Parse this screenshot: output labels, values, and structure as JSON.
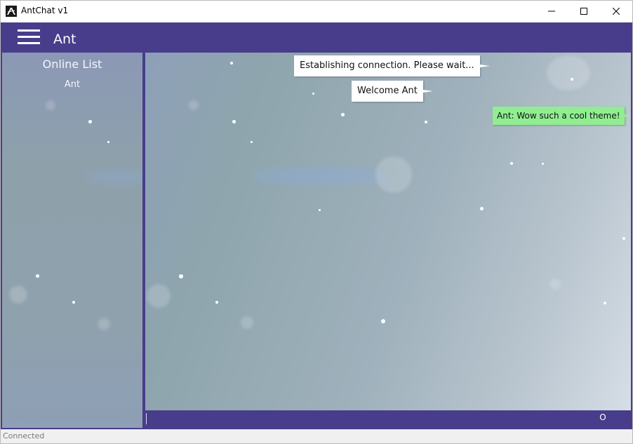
{
  "window": {
    "title": "AntChat v1",
    "controls": [
      "minimize-icon",
      "maximize-icon",
      "close-icon"
    ]
  },
  "header": {
    "menu_icon": "hamburger-menu-icon",
    "username": "Ant",
    "accent_color": "#483d8b"
  },
  "sidebar": {
    "title": "Online List",
    "users": [
      "Ant"
    ]
  },
  "chat": {
    "messages": [
      {
        "text": "Establishing connection. Please wait...",
        "style": "system"
      },
      {
        "text": "Welcome Ant",
        "style": "system"
      },
      {
        "text": "Ant: Wow such a cool theme!",
        "style": "user",
        "color": "#90ee90"
      }
    ]
  },
  "input": {
    "value": "",
    "send_label": "O"
  },
  "status": {
    "text": "Connected"
  }
}
